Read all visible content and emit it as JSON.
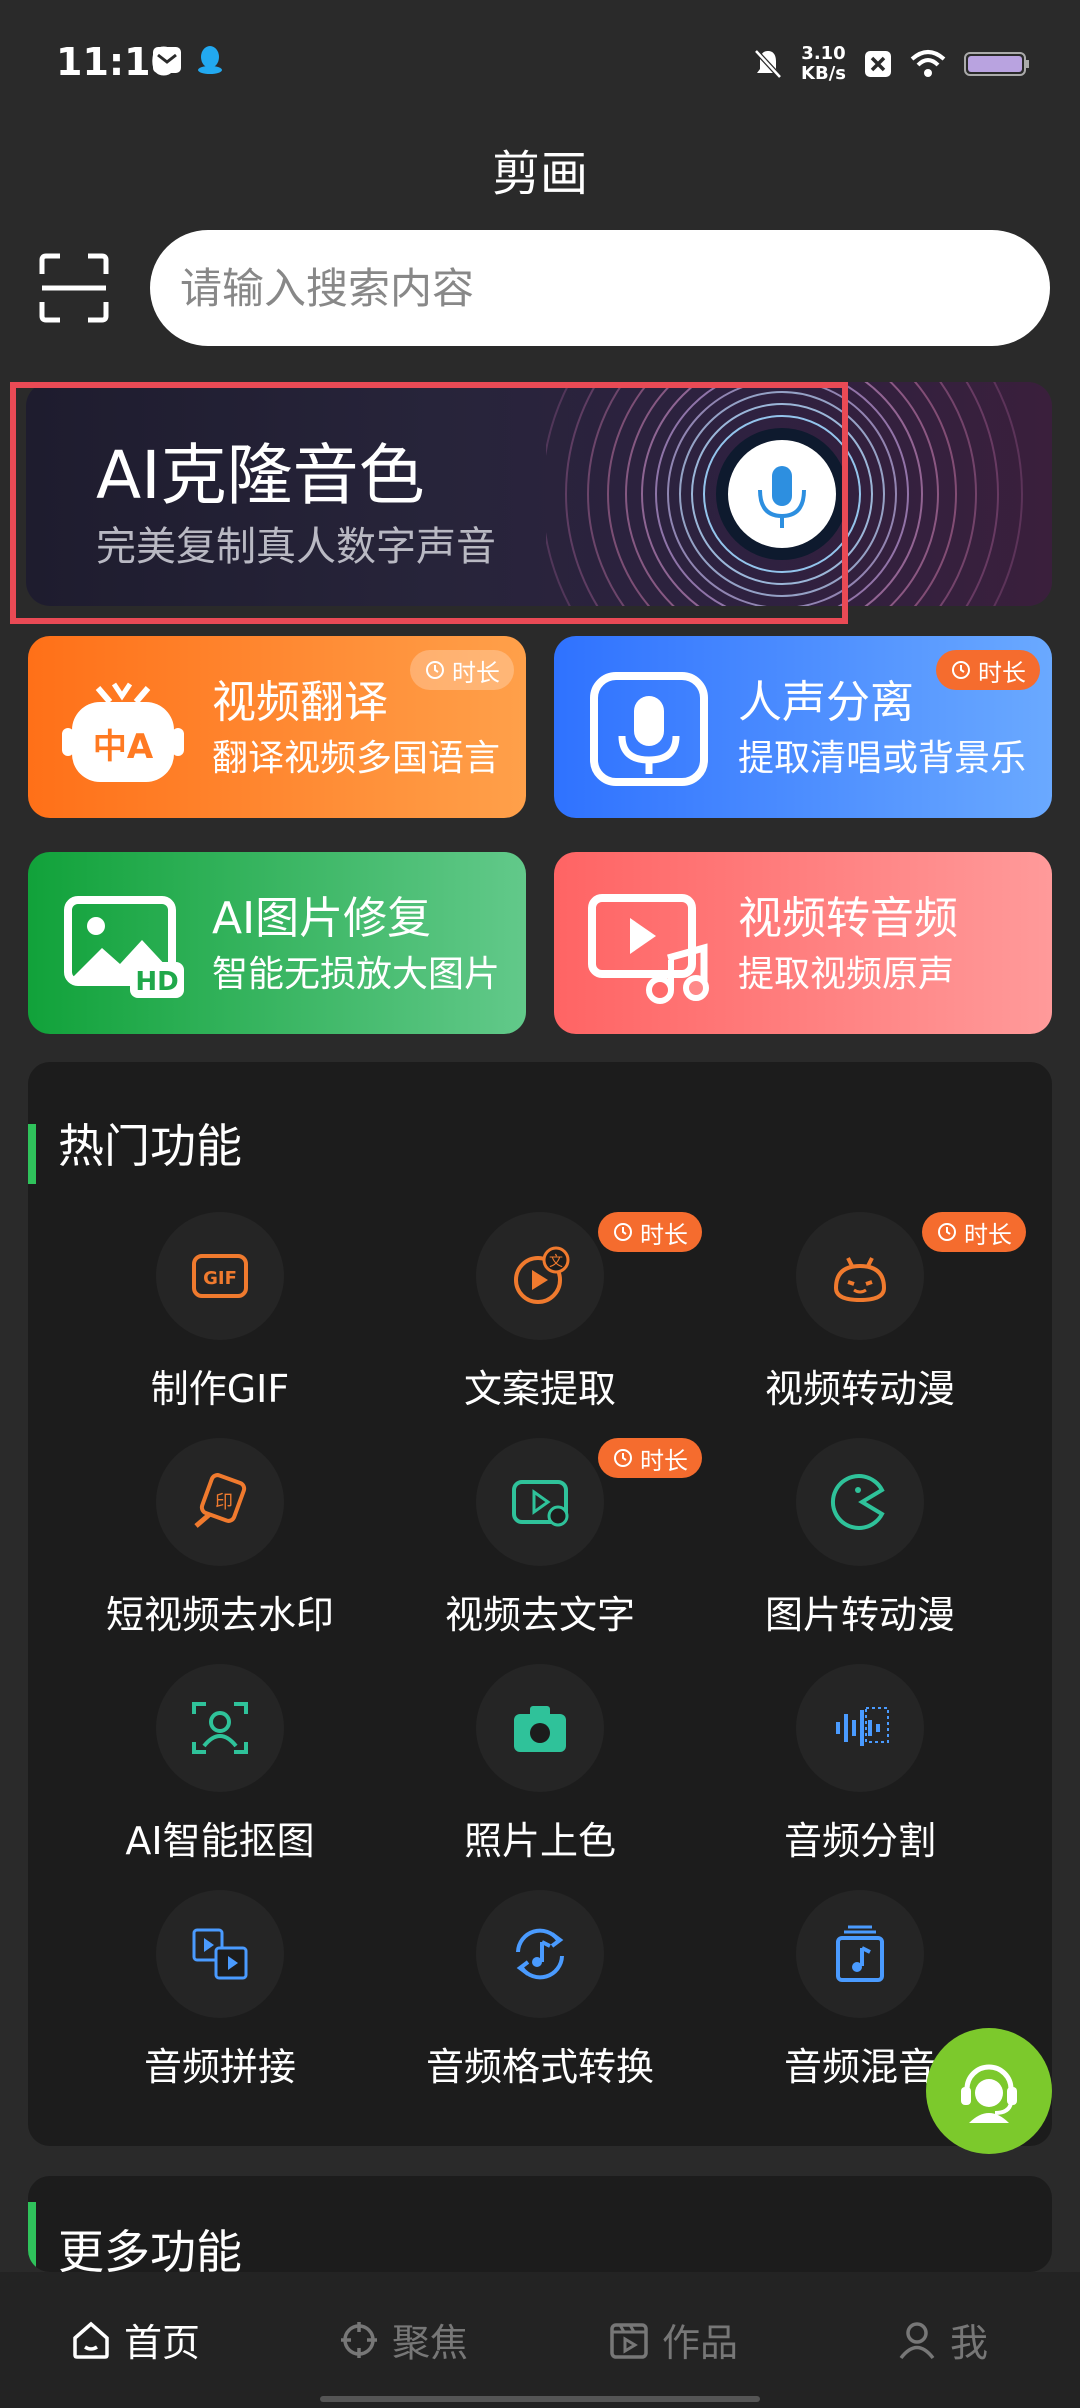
{
  "status": {
    "time": "11:10",
    "speed_value": "3.10",
    "speed_unit": "KB/s"
  },
  "header": {
    "title": "剪画",
    "search_placeholder": "请输入搜索内容"
  },
  "banner": {
    "title": "AI克隆音色",
    "subtitle": "完美复制真人数字声音"
  },
  "cards": [
    {
      "title": "视频翻译",
      "subtitle": "翻译视频多国语言",
      "badge": "时长",
      "icon_text": "中A",
      "color": "#ff7a22"
    },
    {
      "title": "人声分离",
      "subtitle": "提取清唱或背景乐",
      "badge": "时长",
      "color": "#2f7bff"
    },
    {
      "title": "AI图片修复",
      "subtitle": "智能无损放大图片",
      "icon_text": "HD",
      "color": "#20a84a"
    },
    {
      "title": "视频转音频",
      "subtitle": "提取视频原声",
      "color": "#ff6b6b"
    }
  ],
  "hot": {
    "title": "热门功能",
    "badge": "时长",
    "items": [
      {
        "label": "制作GIF",
        "icon": "gif-icon",
        "icon_text": "GIF"
      },
      {
        "label": "文案提取",
        "icon": "text-extract-icon",
        "icon_text": "文"
      },
      {
        "label": "视频转动漫",
        "icon": "anime-face-icon"
      },
      {
        "label": "短视频去水印",
        "icon": "watermark-icon",
        "icon_text": "印"
      },
      {
        "label": "视频去文字",
        "icon": "video-remove-text-icon"
      },
      {
        "label": "图片转动漫",
        "icon": "pacman-icon"
      },
      {
        "label": "AI智能抠图",
        "icon": "cutout-person-icon"
      },
      {
        "label": "照片上色",
        "icon": "camera-icon"
      },
      {
        "label": "音频分割",
        "icon": "audio-split-icon"
      },
      {
        "label": "音频拼接",
        "icon": "film-icon"
      },
      {
        "label": "音频格式转换",
        "icon": "music-convert-icon"
      },
      {
        "label": "音频混音",
        "icon": "music-album-icon"
      }
    ]
  },
  "more": {
    "title": "更多功能"
  },
  "nav": [
    {
      "label": "首页",
      "active": true
    },
    {
      "label": "聚焦",
      "active": false
    },
    {
      "label": "作品",
      "active": false
    },
    {
      "label": "我",
      "active": false
    }
  ],
  "colors": {
    "accent_green": "#2fc25b",
    "badge_orange": "#f56c2e",
    "fab_green": "#7cc92c"
  }
}
